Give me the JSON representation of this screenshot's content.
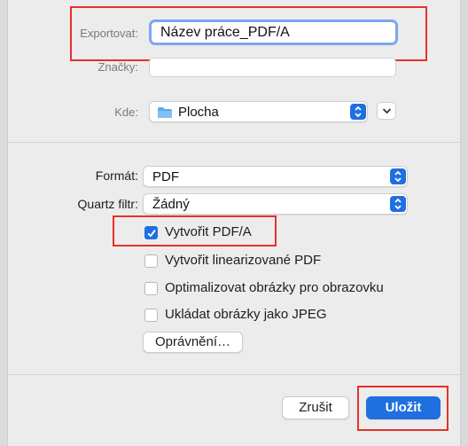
{
  "export_as": {
    "label": "Exportovat:",
    "value": "Název práce_PDF/A"
  },
  "tags": {
    "label": "Značky:",
    "value": ""
  },
  "where": {
    "label": "Kde:",
    "value": "Plocha",
    "icon": "folder-icon"
  },
  "format": {
    "label": "Formát:",
    "value": "PDF"
  },
  "quartz_filter": {
    "label": "Quartz filtr:",
    "value": "Žádný"
  },
  "options": [
    {
      "label": "Vytvořit PDF/A",
      "checked": true
    },
    {
      "label": "Vytvořit linearizované PDF",
      "checked": false
    },
    {
      "label": "Optimalizovat obrázky pro obrazovku",
      "checked": false
    },
    {
      "label": "Ukládat obrázky jako JPEG",
      "checked": false
    }
  ],
  "permissions_button": "Oprávnění…",
  "cancel_button": "Zrušit",
  "save_button": "Uložit",
  "colors": {
    "accent": "#1f6fe0",
    "annotation": "#e5312a"
  }
}
